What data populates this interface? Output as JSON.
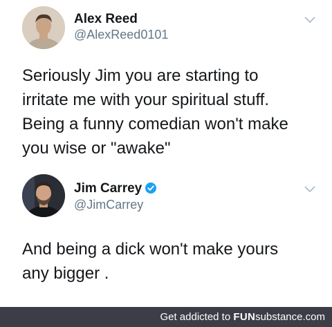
{
  "tweets": [
    {
      "display_name": "Alex Reed",
      "handle": "@AlexReed0101",
      "verified": false,
      "text": "Seriously Jim you are starting to\nirritate me with your spiritual stuff.\nBeing a funny comedian won't make\nyou wise or \"awake\""
    },
    {
      "display_name": "Jim Carrey",
      "handle": "@JimCarrey",
      "verified": true,
      "text": "And being a dick won't make yours\nany bigger ."
    }
  ],
  "colors": {
    "verified_badge": "#1da1f2",
    "footer_background": "#3d3d48",
    "handle_text": "#657786",
    "body_text": "#14171a"
  },
  "icons": {
    "menu": "chevron-down-icon",
    "verified": "verified-badge-icon"
  },
  "footer": {
    "prefix": "Get addicted to ",
    "brand_strong": "FUN",
    "brand_rest": "substance",
    "domain": ".com"
  }
}
